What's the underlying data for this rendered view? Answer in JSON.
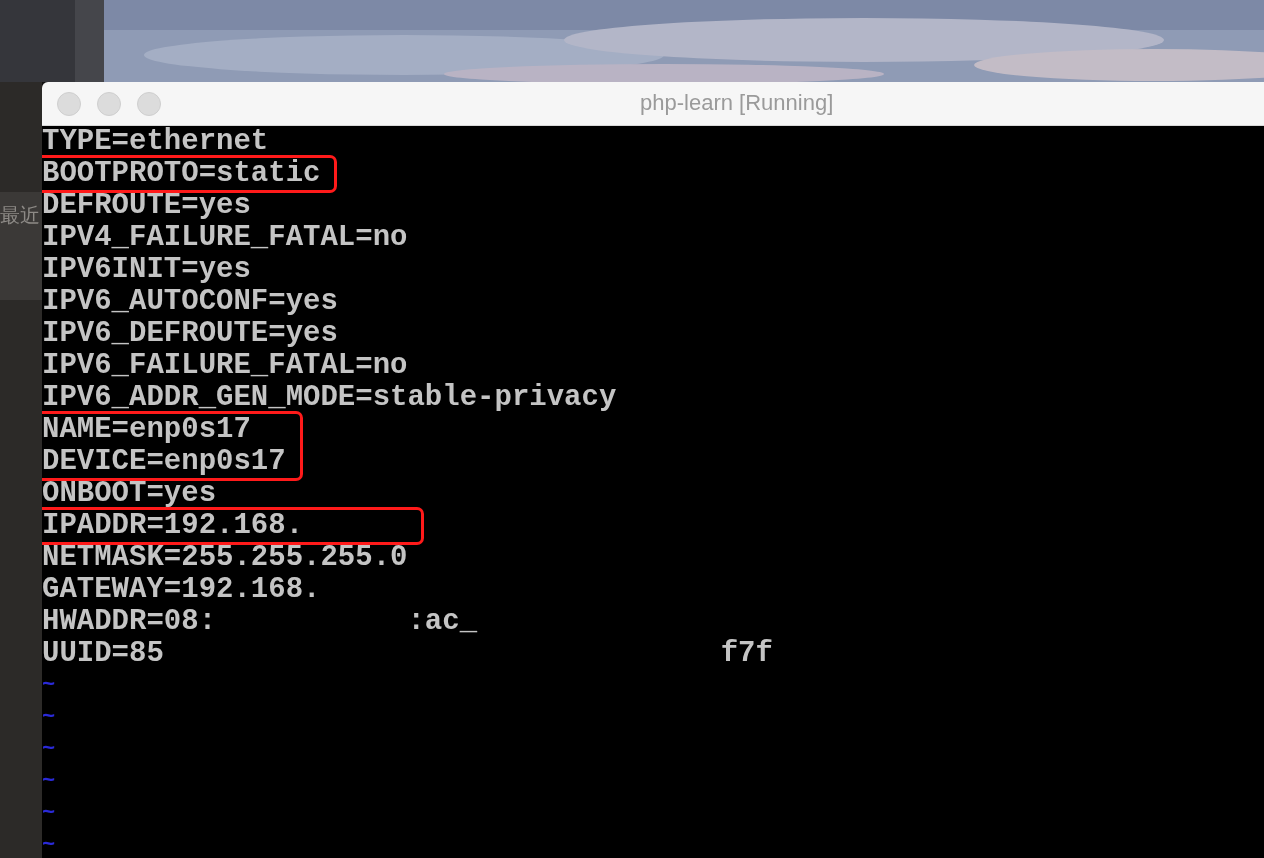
{
  "desktop": {
    "side_text": "最近"
  },
  "window": {
    "title": "php-learn [Running]"
  },
  "terminal": {
    "groups": [
      {
        "highlighted": false,
        "lines": [
          "TYPE=ethernet"
        ]
      },
      {
        "highlighted": true,
        "lines": [
          "BOOTPROTO=static"
        ]
      },
      {
        "highlighted": false,
        "lines": [
          "DEFROUTE=yes",
          "IPV4_FAILURE_FATAL=no",
          "IPV6INIT=yes",
          "IPV6_AUTOCONF=yes",
          "IPV6_DEFROUTE=yes",
          "IPV6_FAILURE_FATAL=no",
          "IPV6_ADDR_GEN_MODE=stable-privacy"
        ]
      },
      {
        "highlighted": true,
        "lines": [
          "NAME=enp0s17",
          "DEVICE=enp0s17"
        ]
      },
      {
        "highlighted": false,
        "lines": [
          "ONBOOT=yes"
        ]
      },
      {
        "highlighted": true,
        "lines": [
          "IPADDR=192.168.      "
        ]
      },
      {
        "highlighted": false,
        "lines": [
          "NETMASK=255.255.255.0",
          "GATEWAY=192.168.",
          "HWADDR=08:           :ac_",
          "UUID=85                                f7f"
        ]
      }
    ],
    "tildes": [
      "~",
      "~",
      "~",
      "~",
      "~",
      "~"
    ]
  }
}
